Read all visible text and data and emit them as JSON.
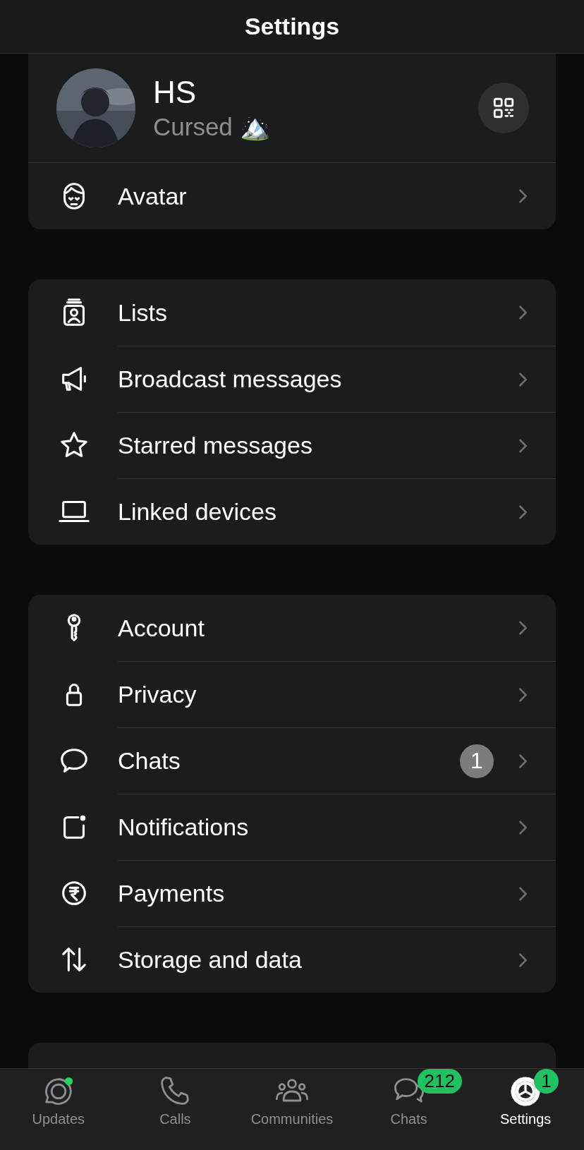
{
  "header": {
    "title": "Settings"
  },
  "profile": {
    "name": "HS",
    "status": "Cursed 🏔️"
  },
  "sections": [
    {
      "items": [
        {
          "label": "Avatar",
          "kind": "avatar"
        }
      ]
    },
    {
      "items": [
        {
          "label": "Lists",
          "kind": "lists"
        },
        {
          "label": "Broadcast messages",
          "kind": "megaphone"
        },
        {
          "label": "Starred messages",
          "kind": "star"
        },
        {
          "label": "Linked devices",
          "kind": "laptop"
        }
      ]
    },
    {
      "items": [
        {
          "label": "Account",
          "kind": "key"
        },
        {
          "label": "Privacy",
          "kind": "lock"
        },
        {
          "label": "Chats",
          "kind": "bubble",
          "badge": "1"
        },
        {
          "label": "Notifications",
          "kind": "notif"
        },
        {
          "label": "Payments",
          "kind": "rupee"
        },
        {
          "label": "Storage and data",
          "kind": "arrows"
        }
      ]
    }
  ],
  "tabs": [
    {
      "label": "Updates",
      "kind": "updates",
      "selected": false,
      "dot": true
    },
    {
      "label": "Calls",
      "kind": "phone",
      "selected": false,
      "dot": false
    },
    {
      "label": "Communities",
      "kind": "people",
      "selected": false,
      "dot": false
    },
    {
      "label": "Chats",
      "kind": "chats",
      "selected": false,
      "dot": false,
      "badge": "212"
    },
    {
      "label": "Settings",
      "kind": "gear",
      "selected": true,
      "dot": false,
      "badge": "1"
    }
  ]
}
